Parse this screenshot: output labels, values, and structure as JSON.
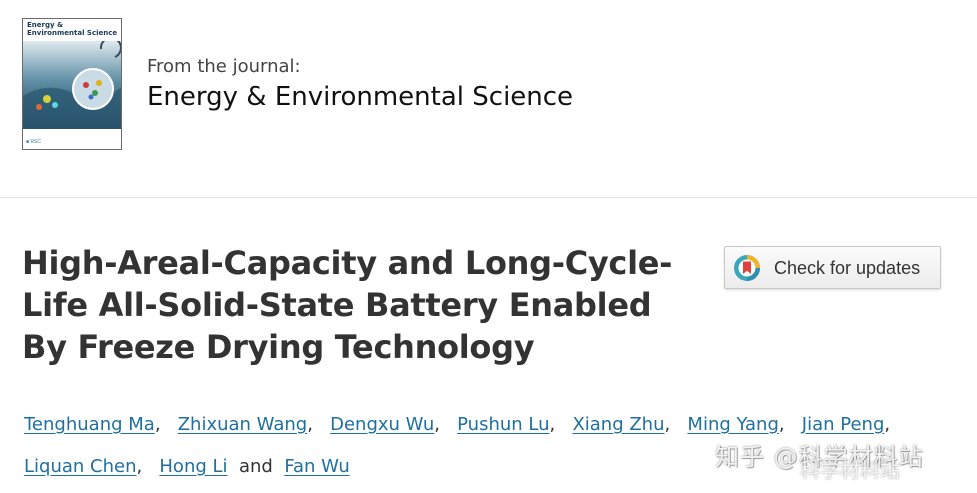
{
  "journal": {
    "cover_title": "Energy & Environmental Science",
    "from_label": "From the journal:",
    "name": "Energy & Environmental Science"
  },
  "article": {
    "title": "High-Areal-Capacity and Long-Cycle-Life All-Solid-State Battery Enabled By Freeze Drying Technology"
  },
  "check_updates": {
    "label": "Check for updates",
    "icon": "crossmark-icon"
  },
  "authors": [
    "Tenghuang Ma",
    "Zhixuan Wang",
    "Dengxu Wu",
    "Pushun Lu",
    "Xiang Zhu",
    "Ming Yang",
    "Jian Peng",
    "Liquan Chen",
    "Hong Li",
    "Fan Wu"
  ],
  "authors_and": "and",
  "authors_sep": ",",
  "watermark": {
    "text": "知乎 @科学材料站",
    "sub": "科学材料站"
  },
  "colors": {
    "link": "#1f6f9f",
    "title": "#333333"
  }
}
